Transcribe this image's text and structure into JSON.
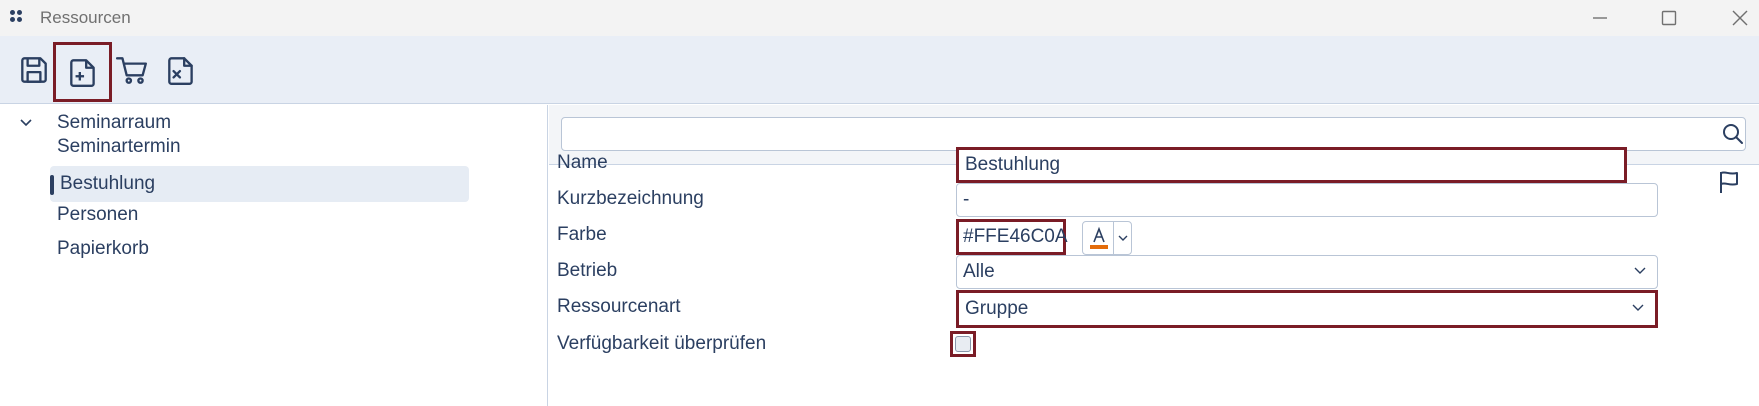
{
  "window": {
    "title": "Ressourcen"
  },
  "toolbar": {
    "buttons": [
      {
        "icon": "save-icon"
      },
      {
        "icon": "new-document-icon"
      },
      {
        "icon": "cart-icon"
      },
      {
        "icon": "delete-document-icon"
      }
    ]
  },
  "sidebar": {
    "items": [
      {
        "label": "Seminarraum",
        "expanded": true
      },
      {
        "label": "Seminartermin"
      },
      {
        "label": "Bestuhlung",
        "selected": true
      },
      {
        "label": "Personen"
      },
      {
        "label": "Papierkorb"
      }
    ]
  },
  "search": {
    "value": "",
    "placeholder": ""
  },
  "form": {
    "name": {
      "label": "Name",
      "value": "Bestuhlung"
    },
    "kurz": {
      "label": "Kurzbezeichnung",
      "value": "-"
    },
    "farbe": {
      "label": "Farbe",
      "value": "#FFE46C0A",
      "swatch": "#E46C0A"
    },
    "betrieb": {
      "label": "Betrieb",
      "value": "Alle"
    },
    "ressourcenart": {
      "label": "Ressourcenart",
      "value": "Gruppe"
    },
    "verfuegbarkeit": {
      "label": "Verfügbarkeit überprüfen",
      "checked": false
    }
  },
  "colors": {
    "accent": "#7a1c26",
    "text": "#2b3f61",
    "toolbar_bg": "#e9eef6"
  }
}
